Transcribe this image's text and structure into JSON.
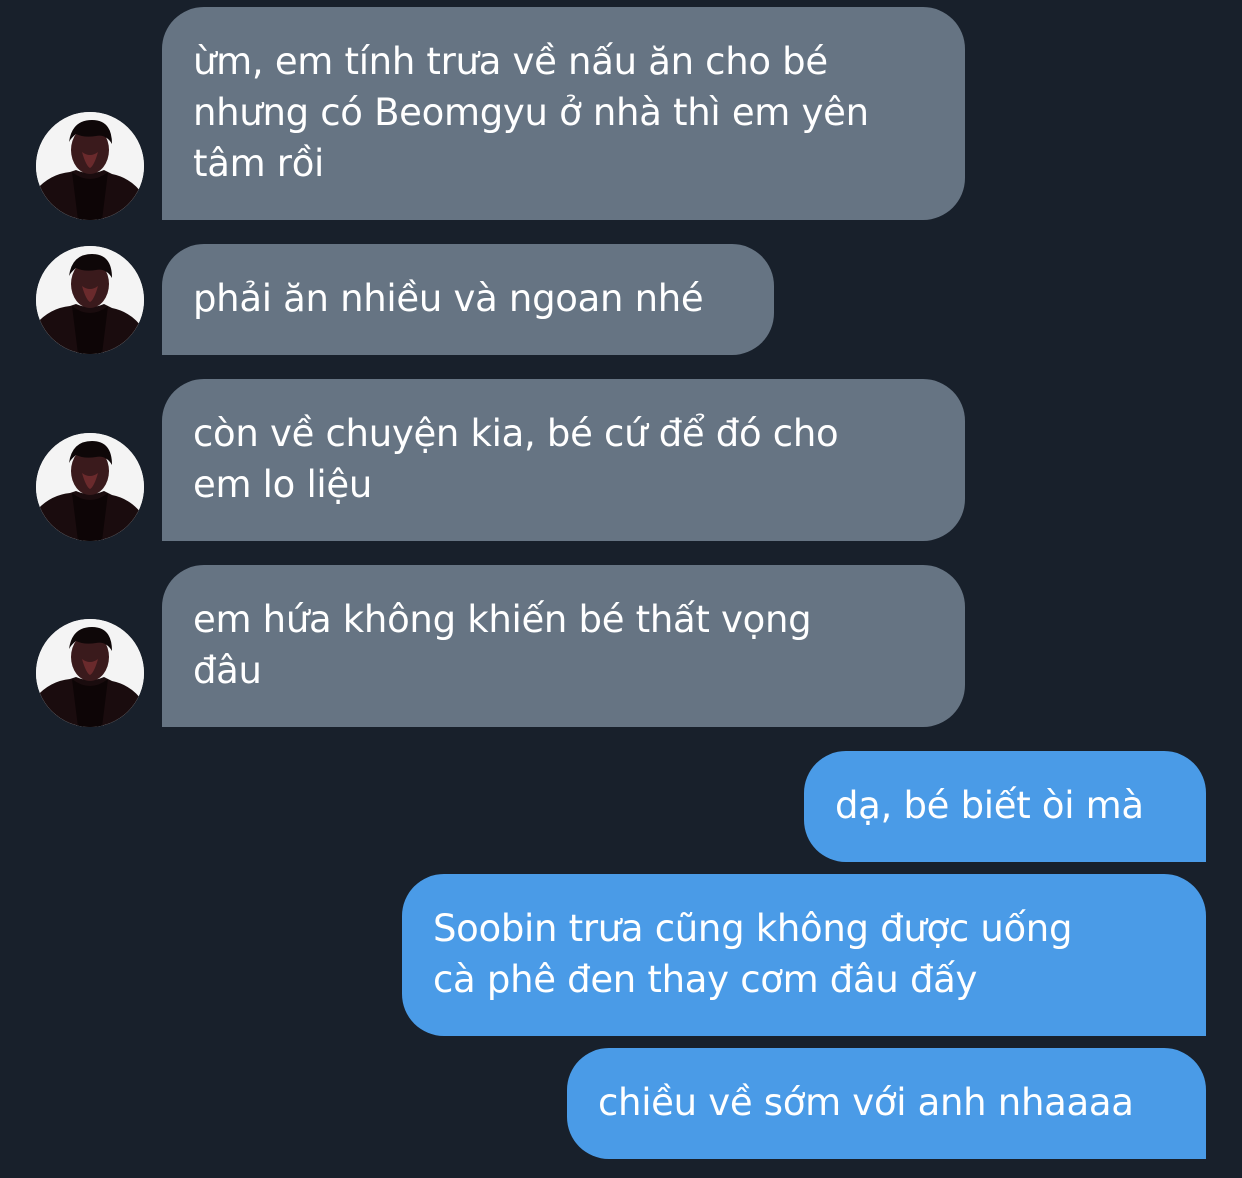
{
  "chat": {
    "colors": {
      "background": "#18202b",
      "incoming_bubble": "#667483",
      "outgoing_bubble": "#4a9be7",
      "text": "#ffffff"
    },
    "messages": [
      {
        "side": "incoming",
        "text": "ừm, em tính trưa về nấu ăn cho bé\nnhưng có Beomgyu ở nhà thì em yên\ntâm rồi"
      },
      {
        "side": "incoming",
        "text": "phải ăn nhiều và ngoan nhé"
      },
      {
        "side": "incoming",
        "text": "còn về chuyện kia, bé cứ để đó cho\nem lo liệu"
      },
      {
        "side": "incoming",
        "text": "em hứa không khiến bé thất vọng\nđâu"
      },
      {
        "side": "outgoing",
        "text": "dạ, bé biết òi mà"
      },
      {
        "side": "outgoing",
        "text": "Soobin trưa cũng không được uống\ncà phê đen thay cơm đâu đấy"
      },
      {
        "side": "outgoing",
        "text": "chiều về sớm với anh nhaaaa"
      }
    ]
  }
}
